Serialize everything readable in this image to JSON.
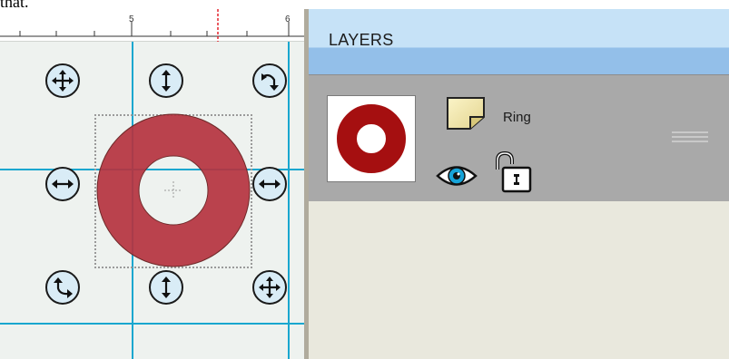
{
  "top_fragment": "that.",
  "ruler": {
    "labels": [
      "5",
      "6"
    ]
  },
  "layers_panel": {
    "title": "LAYERS",
    "layers": [
      {
        "name": "Ring",
        "visible": true,
        "locked": false
      }
    ]
  },
  "colors": {
    "ring_fill": "#b5333f",
    "thumb_ring": "#a50f10",
    "guide": "#19a7cf",
    "handle_fill": "#d9ecf6",
    "header_top": "#c6e2f7",
    "header_bottom": "#93bfe9",
    "layer_row": "#a9a9a9",
    "panel_bg": "#e9e8dd"
  },
  "icons": {
    "handles": [
      "move-icon",
      "vertical-resize-icon",
      "rotate-icon",
      "horizontal-resize-icon",
      "horizontal-resize-icon",
      "rotate-icon",
      "vertical-resize-icon",
      "move-icon"
    ],
    "layer": [
      "shape-layer-icon",
      "eye-icon",
      "unlocked-padlock-icon",
      "drag-handle-icon"
    ]
  }
}
